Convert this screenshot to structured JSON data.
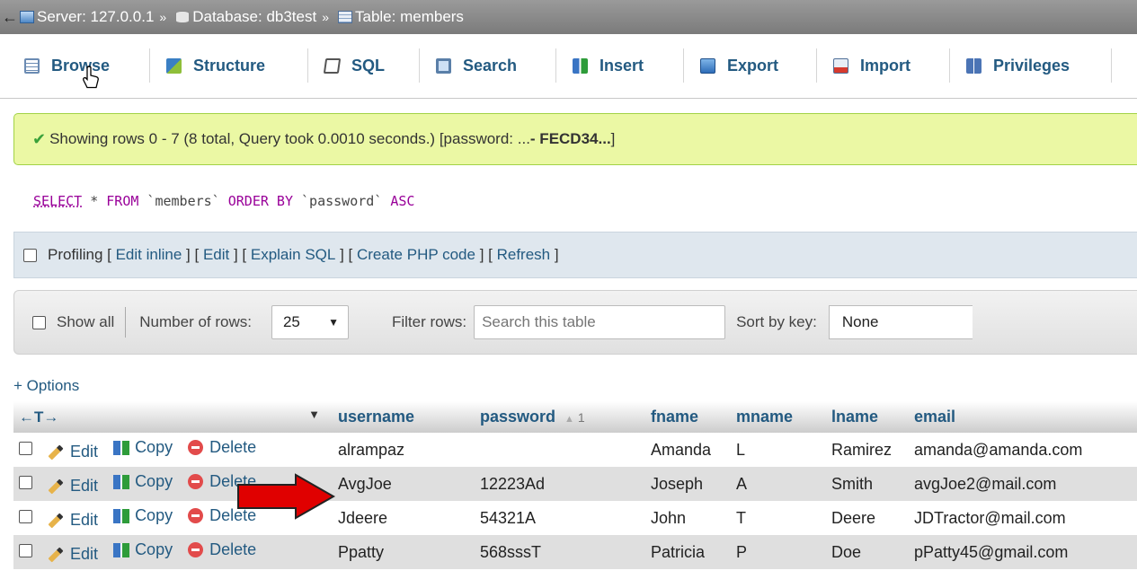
{
  "breadcrumb": {
    "back_glyph": "←",
    "items": [
      {
        "label": "Server: 127.0.0.1",
        "icon": "server-icon"
      },
      {
        "label": "Database: db3test",
        "icon": "database-icon"
      },
      {
        "label": "Table: members",
        "icon": "table-icon"
      }
    ],
    "separator": "»"
  },
  "tabs": [
    {
      "label": "Browse",
      "icon": "browse-icon"
    },
    {
      "label": "Structure",
      "icon": "structure-icon"
    },
    {
      "label": "SQL",
      "icon": "sql-icon"
    },
    {
      "label": "Search",
      "icon": "search-icon"
    },
    {
      "label": "Insert",
      "icon": "insert-icon"
    },
    {
      "label": "Export",
      "icon": "export-icon"
    },
    {
      "label": "Import",
      "icon": "import-icon"
    },
    {
      "label": "Privileges",
      "icon": "privileges-icon"
    }
  ],
  "message": {
    "text": "Showing rows 0 - 7 (8 total, Query took 0.0010 seconds.) [password: ... ",
    "bold": "- FECD34...",
    "end": "]"
  },
  "sql": {
    "select": "SELECT",
    "star": " * ",
    "from": "FROM",
    "table": " `members` ",
    "order": "ORDER BY",
    "col": " `password` ",
    "asc": "ASC"
  },
  "profiling": {
    "label": "Profiling",
    "links": [
      "Edit inline",
      "Edit",
      "Explain SQL",
      "Create PHP code",
      "Refresh"
    ]
  },
  "nav": {
    "show_all": "Show all",
    "rows_label": "Number of rows:",
    "rows_value": "25",
    "filter_label": "Filter rows:",
    "filter_placeholder": "Search this table",
    "sort_label": "Sort by key:",
    "sort_value": "None"
  },
  "options_label": "+ Options",
  "table": {
    "col_arrows": "←T→",
    "headers": {
      "username": "username",
      "password": "password",
      "sort_index": "1",
      "fname": "fname",
      "mname": "mname",
      "lname": "lname",
      "email": "email"
    },
    "actions": {
      "edit": "Edit",
      "copy": "Copy",
      "delete": "Delete"
    },
    "rows": [
      {
        "username": "alrampaz",
        "password": "",
        "fname": "Amanda",
        "mname": "L",
        "lname": "Ramirez",
        "email": "amanda@amanda.com"
      },
      {
        "username": "AvgJoe",
        "password": "12223Ad",
        "fname": "Joseph",
        "mname": "A",
        "lname": "Smith",
        "email": "avgJoe2@mail.com"
      },
      {
        "username": "Jdeere",
        "password": "54321A",
        "fname": "John",
        "mname": "T",
        "lname": "Deere",
        "email": "JDTractor@mail.com"
      },
      {
        "username": "Ppatty",
        "password": "568sssT",
        "fname": "Patricia",
        "mname": "P",
        "lname": "Doe",
        "email": "pPatty45@gmail.com"
      }
    ]
  },
  "colors": {
    "link": "#235a81",
    "success_bg": "#ebf8a4",
    "annotation_arrow": "#e00000"
  }
}
